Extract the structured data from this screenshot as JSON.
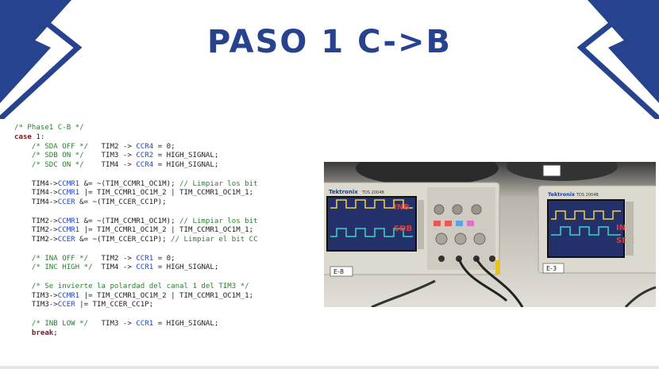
{
  "slide": {
    "title": "PASO 1 C->B",
    "colors": {
      "brand": "#27438f",
      "code_comment": "#2e7d32",
      "code_keyword": "#7a1a1a",
      "code_register": "#2145c8",
      "photo_label": "#e53935"
    }
  },
  "code": {
    "lines": [
      [
        {
          "t": "/* Phase1 C-B */",
          "c": "comment"
        }
      ],
      [
        {
          "t": "case",
          "c": "kw"
        },
        {
          "t": " 1:",
          "c": "plain"
        }
      ],
      [
        {
          "t": "    ",
          "c": "plain"
        },
        {
          "t": "/* SDA OFF */",
          "c": "comment"
        },
        {
          "t": "   TIM2 -> ",
          "c": "plain"
        },
        {
          "t": "CCR4",
          "c": "reg"
        },
        {
          "t": " = 0;",
          "c": "plain"
        }
      ],
      [
        {
          "t": "    ",
          "c": "plain"
        },
        {
          "t": "/* SDB ON */",
          "c": "comment"
        },
        {
          "t": "    TIM3 -> ",
          "c": "plain"
        },
        {
          "t": "CCR2",
          "c": "reg"
        },
        {
          "t": " = HIGH_SIGNAL;",
          "c": "plain"
        }
      ],
      [
        {
          "t": "    ",
          "c": "plain"
        },
        {
          "t": "/* SDC ON */",
          "c": "comment"
        },
        {
          "t": "    TIM4 -> ",
          "c": "plain"
        },
        {
          "t": "CCR4",
          "c": "reg"
        },
        {
          "t": " = HIGH_SIGNAL;",
          "c": "plain"
        }
      ],
      [],
      [
        {
          "t": "    TIM4->",
          "c": "plain"
        },
        {
          "t": "CCMR1",
          "c": "reg"
        },
        {
          "t": " &= ~(TIM_CCMR1_OC1M); ",
          "c": "plain"
        },
        {
          "t": "// Limpiar los bit",
          "c": "comment"
        }
      ],
      [
        {
          "t": "    TIM4->",
          "c": "plain"
        },
        {
          "t": "CCMR1",
          "c": "reg"
        },
        {
          "t": " |= TIM_CCMR1_OC1M_2 | TIM_CCMR1_OC1M_1;",
          "c": "plain"
        }
      ],
      [
        {
          "t": "    TIM4->",
          "c": "plain"
        },
        {
          "t": "CCER",
          "c": "reg"
        },
        {
          "t": " &= ~(TIM_CCER_CC1P);",
          "c": "plain"
        }
      ],
      [],
      [
        {
          "t": "    TIM2->",
          "c": "plain"
        },
        {
          "t": "CCMR1",
          "c": "reg"
        },
        {
          "t": " &= ~(TIM_CCMR1_OC1M); ",
          "c": "plain"
        },
        {
          "t": "// Limpiar los bit",
          "c": "comment"
        }
      ],
      [
        {
          "t": "    TIM2->",
          "c": "plain"
        },
        {
          "t": "CCMR1",
          "c": "reg"
        },
        {
          "t": " |= TIM_CCMR1_OC1M_2 | TIM_CCMR1_OC1M_1;",
          "c": "plain"
        }
      ],
      [
        {
          "t": "    TIM2->",
          "c": "plain"
        },
        {
          "t": "CCER",
          "c": "reg"
        },
        {
          "t": " &= ~(TIM_CCER_CC1P); ",
          "c": "plain"
        },
        {
          "t": "// Limpiar el bit CC",
          "c": "comment"
        }
      ],
      [],
      [
        {
          "t": "    ",
          "c": "plain"
        },
        {
          "t": "/* INA OFF */",
          "c": "comment"
        },
        {
          "t": "   TIM2 -> ",
          "c": "plain"
        },
        {
          "t": "CCR1",
          "c": "reg"
        },
        {
          "t": " = 0;",
          "c": "plain"
        }
      ],
      [
        {
          "t": "    ",
          "c": "plain"
        },
        {
          "t": "/* INC HIGH */",
          "c": "comment"
        },
        {
          "t": "  TIM4 -> ",
          "c": "plain"
        },
        {
          "t": "CCR1",
          "c": "reg"
        },
        {
          "t": " = HIGH_SIGNAL;",
          "c": "plain"
        }
      ],
      [],
      [
        {
          "t": "    ",
          "c": "plain"
        },
        {
          "t": "/* Se invierte la polardad del canal 1 del TIM3 */",
          "c": "comment"
        }
      ],
      [
        {
          "t": "    TIM3->",
          "c": "plain"
        },
        {
          "t": "CCMR1",
          "c": "reg"
        },
        {
          "t": " |= TIM_CCMR1_OC1M_2 | TIM_CCMR1_OC1M_1;",
          "c": "plain"
        }
      ],
      [
        {
          "t": "    TIM3->",
          "c": "plain"
        },
        {
          "t": "CCER",
          "c": "reg"
        },
        {
          "t": " |= TIM_CCER_CC1P;",
          "c": "plain"
        }
      ],
      [],
      [
        {
          "t": "    ",
          "c": "plain"
        },
        {
          "t": "/* INB LOW */",
          "c": "comment"
        },
        {
          "t": "   TIM3 -> ",
          "c": "plain"
        },
        {
          "t": "CCR1",
          "c": "reg"
        },
        {
          "t": " = HIGH_SIGNAL;",
          "c": "plain"
        }
      ],
      [
        {
          "t": "    ",
          "c": "plain"
        },
        {
          "t": "break",
          "c": "kw"
        },
        {
          "t": ";",
          "c": "plain"
        }
      ]
    ]
  },
  "photo": {
    "left_scope": {
      "brand": "Tektronix",
      "model": "TDS 2004B",
      "labels": [
        "INB",
        "SDB"
      ],
      "sticker": "E-8"
    },
    "right_scope": {
      "brand": "Tektronix",
      "model": "TDS 2004B",
      "labels": [
        "INC",
        "SDC"
      ],
      "sticker": "E-3"
    }
  }
}
